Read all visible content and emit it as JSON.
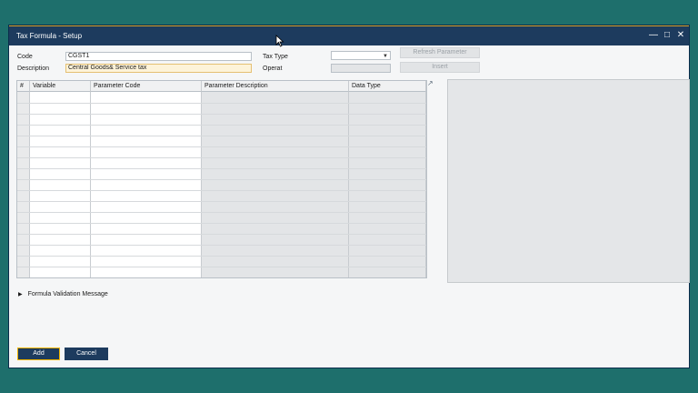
{
  "window": {
    "title": "Tax Formula - Setup"
  },
  "form": {
    "code_label": "Code",
    "code_value": "CGST1",
    "description_label": "Description",
    "description_value": "Central Goods& Service tax",
    "tax_type_label": "Tax Type",
    "tax_type_value": "",
    "operator_label": "Operat",
    "operator_value": ""
  },
  "buttons": {
    "refresh_parameter": "Refresh Parameter",
    "insert": "Insert",
    "add": "Add",
    "cancel": "Cancel"
  },
  "grid": {
    "columns": [
      "#",
      "Variable",
      "Parameter Code",
      "Parameter Description",
      "Data Type"
    ],
    "rows": 17
  },
  "formula_validation": {
    "label": "Formula Validation Message"
  },
  "colors": {
    "background": "#1e6f6c",
    "titlebar": "#1d3b5e",
    "highlight_field": "#fdf3d9",
    "primary_button": "#1d3b5e",
    "primary_button_border": "#f0b400"
  },
  "icons": [
    "minimize-icon",
    "maximize-icon",
    "close-icon",
    "expand-icon",
    "expand-triangle-icon",
    "mouse-cursor-icon",
    "dropdown-arrow-icon"
  ]
}
